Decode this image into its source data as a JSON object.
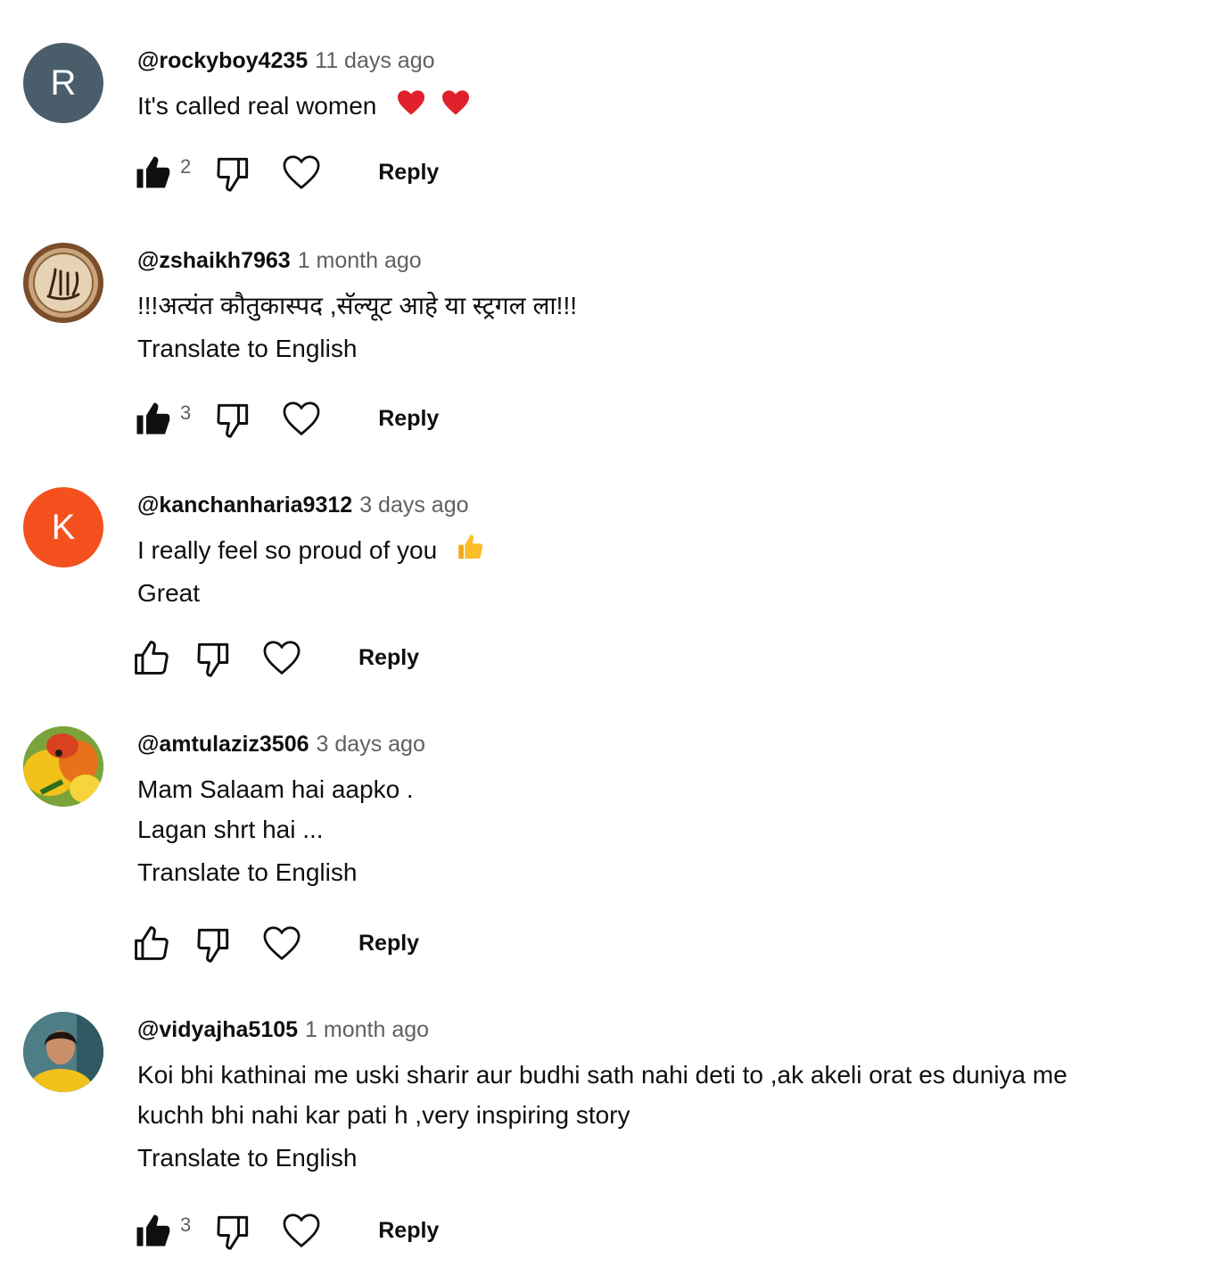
{
  "comments": [
    {
      "author": "@rockyboy4235",
      "time": "11 days ago",
      "lines": [
        "It's called real women"
      ],
      "likes": "2",
      "reply_label": "Reply",
      "avatar_letter": "R",
      "avatar_color": "#4a5d6b"
    },
    {
      "author": "@zshaikh7963",
      "time": "1 month ago",
      "lines": [
        "!!!अत्यंत कौतुकास्पद ,सॅल्यूट आहे या स्ट्रगल ला!!!"
      ],
      "translate_label": "Translate to English",
      "likes": "3",
      "reply_label": "Reply"
    },
    {
      "author": "@kanchanharia9312",
      "time": "3 days ago",
      "lines": [
        "I really feel so proud of you",
        "Great"
      ],
      "reply_label": "Reply",
      "avatar_letter": "K",
      "avatar_color": "#f4511e"
    },
    {
      "author": "@amtulaziz3506",
      "time": "3 days ago",
      "lines": [
        "Mam Salaam hai aapko .",
        "Lagan  shrt hai  ..."
      ],
      "translate_label": "Translate to English",
      "reply_label": "Reply"
    },
    {
      "author": "@vidyajha5105",
      "time": "1 month ago",
      "lines": [
        "Koi bhi kathinai me uski  sharir aur budhi sath nahi deti to ,ak akeli orat es duniya me",
        "kuchh bhi nahi kar pati h ,very inspiring story"
      ],
      "translate_label": "Translate to English",
      "likes": "3",
      "reply_label": "Reply"
    }
  ],
  "icons": {
    "like": "thumbs-up-icon",
    "dislike": "thumbs-down-icon",
    "heart": "heart-outline-icon",
    "emoji_heart": "red-heart-emoji",
    "emoji_thumbs": "thumbs-up-emoji"
  }
}
